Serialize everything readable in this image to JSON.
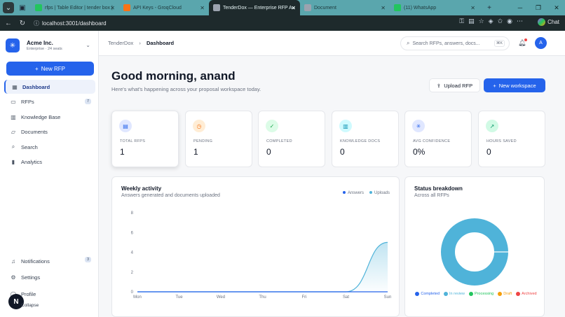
{
  "browser": {
    "tabs": [
      {
        "title": "rfps | Table Editor | tender box |",
        "favicon_color": "#22c55e",
        "active": false
      },
      {
        "title": "API Keys - GroqCloud",
        "favicon_color": "#f97316",
        "active": false
      },
      {
        "title": "TenderDox — Enterprise RFP Au",
        "favicon_color": "#9ca3af",
        "active": true
      },
      {
        "title": "Document",
        "favicon_color": "#9ca3af",
        "active": false
      },
      {
        "title": "(11) WhatsApp",
        "favicon_color": "#22c55e",
        "active": false
      }
    ],
    "url": "localhost:3001/dashboard",
    "chat_label": "Chat"
  },
  "sidebar": {
    "org_name": "Acme Inc.",
    "org_sub": "Enterprise · 24 seats",
    "new_rfp_label": "New RFP",
    "items": [
      {
        "label": "Dashboard",
        "icon": "grid-icon",
        "active": true,
        "badge": ""
      },
      {
        "label": "RFPs",
        "icon": "file-icon",
        "active": false,
        "badge": "7"
      },
      {
        "label": "Knowledge Base",
        "icon": "book-icon",
        "active": false,
        "badge": ""
      },
      {
        "label": "Documents",
        "icon": "folder-icon",
        "active": false,
        "badge": ""
      },
      {
        "label": "Search",
        "icon": "search-icon",
        "active": false,
        "badge": ""
      },
      {
        "label": "Analytics",
        "icon": "bar-chart-icon",
        "active": false,
        "badge": ""
      }
    ],
    "bottom_items": [
      {
        "label": "Notifications",
        "icon": "bell-icon",
        "badge": "3"
      },
      {
        "label": "Settings",
        "icon": "gear-icon",
        "badge": ""
      },
      {
        "label": "Profile",
        "icon": "user-icon",
        "badge": ""
      }
    ],
    "collapse_label": "Collapse",
    "floating_badge": "N"
  },
  "topbar": {
    "breadcrumb_root": "TenderDox",
    "breadcrumb_current": "Dashboard",
    "search_placeholder": "Search RFPs, answers, docs...",
    "search_shortcut": "⌘K",
    "avatar_initial": "A"
  },
  "header": {
    "greeting": "Good morning, anand",
    "subtitle": "Here's what's happening across your proposal workspace today.",
    "upload_label": "Upload RFP",
    "new_workspace_label": "New workspace"
  },
  "stats": [
    {
      "label": "TOTAL RFPS",
      "value": "1",
      "icon": "document-icon",
      "color": "#2563eb",
      "bg": "#e0e7ff"
    },
    {
      "label": "PENDING",
      "value": "1",
      "icon": "clock-icon",
      "color": "#f97316",
      "bg": "#ffedd5"
    },
    {
      "label": "COMPLETED",
      "value": "0",
      "icon": "check-circle-icon",
      "color": "#16a34a",
      "bg": "#dcfce7"
    },
    {
      "label": "KNOWLEDGE DOCS",
      "value": "0",
      "icon": "book-open-icon",
      "color": "#0891b2",
      "bg": "#cffafe"
    },
    {
      "label": "AVG CONFIDENCE",
      "value": "0%",
      "icon": "sparkle-icon",
      "color": "#2563eb",
      "bg": "#e0e7ff"
    },
    {
      "label": "HOURS SAVED",
      "value": "0",
      "icon": "trending-up-icon",
      "color": "#059669",
      "bg": "#d1fae5"
    }
  ],
  "weekly": {
    "title": "Weekly activity",
    "subtitle": "Answers generated and documents uploaded"
  },
  "status": {
    "title": "Status breakdown",
    "subtitle": "Across all RFPs",
    "legend": [
      {
        "label": "Completed",
        "color": "#2563eb"
      },
      {
        "label": "In review",
        "color": "#4fb3d9"
      },
      {
        "label": "Processing",
        "color": "#22c55e"
      },
      {
        "label": "Draft",
        "color": "#f59e0b"
      },
      {
        "label": "Archived",
        "color": "#ef4444"
      }
    ]
  },
  "chart_data": [
    {
      "type": "area",
      "categories": [
        "Mon",
        "Tue",
        "Wed",
        "Thu",
        "Fri",
        "Sat",
        "Sun"
      ],
      "series": [
        {
          "name": "Answers",
          "color": "#2563eb",
          "values": [
            0,
            0,
            0,
            0,
            0,
            0,
            0
          ]
        },
        {
          "name": "Uploads",
          "color": "#4fb3d9",
          "values": [
            0,
            0,
            0,
            0,
            0,
            0,
            5
          ]
        }
      ],
      "yticks": [
        0,
        2,
        4,
        6,
        8
      ],
      "ylim": [
        0,
        8
      ],
      "grid": false,
      "legend": "top-right"
    },
    {
      "type": "pie",
      "donut": true,
      "categories": [
        "Completed",
        "In review",
        "Processing",
        "Draft",
        "Archived"
      ],
      "values": [
        0,
        1,
        0,
        0,
        0
      ],
      "legend": "bottom"
    }
  ]
}
